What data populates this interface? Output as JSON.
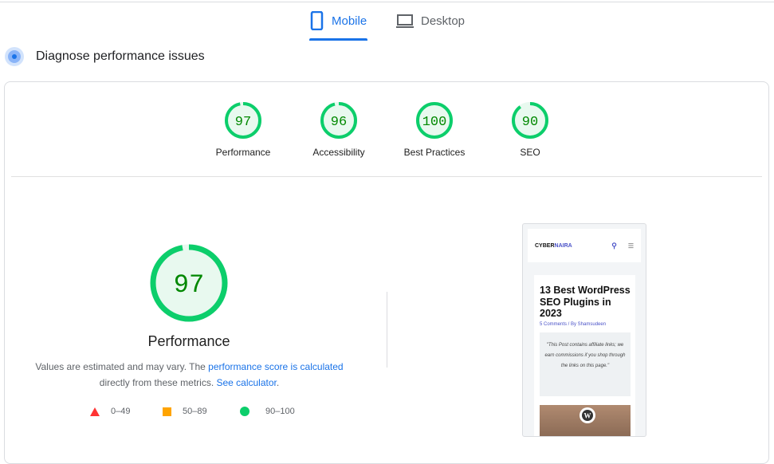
{
  "tabs": [
    {
      "label": "Mobile",
      "active": true
    },
    {
      "label": "Desktop",
      "active": false
    }
  ],
  "section_title": "Diagnose performance issues",
  "gauges": [
    {
      "score": "97",
      "label": "Performance",
      "value": 97
    },
    {
      "score": "96",
      "label": "Accessibility",
      "value": 96
    },
    {
      "score": "100",
      "label": "Best Practices",
      "value": 100
    },
    {
      "score": "90",
      "label": "SEO",
      "value": 90
    }
  ],
  "main": {
    "score": "97",
    "title": "Performance",
    "desc_pre": "Values are estimated and may vary. The ",
    "link1": "performance score is calculated",
    "desc_mid": " directly from these metrics. ",
    "link2": "See calculator",
    "desc_end": "."
  },
  "legend": [
    {
      "range": "0–49",
      "color": "#ff3333"
    },
    {
      "range": "50–89",
      "color": "#ffa400"
    },
    {
      "range": "90–100",
      "color": "#0cce6b"
    }
  ],
  "screenshot": {
    "brand1": "CYBER",
    "brand2": "NAIRA",
    "title": "13 Best WordPress SEO Plugins in 2023",
    "meta": "5 Comments / By Shamsudeen",
    "quote": "\"This Post contains affiliate links; we earn commissions if you shop through the links on this page.\""
  },
  "colors": {
    "pass": "#0cce6b",
    "pass_text": "#008800",
    "pass_bg": "#e8f9ef",
    "accent": "#1a73e8"
  }
}
